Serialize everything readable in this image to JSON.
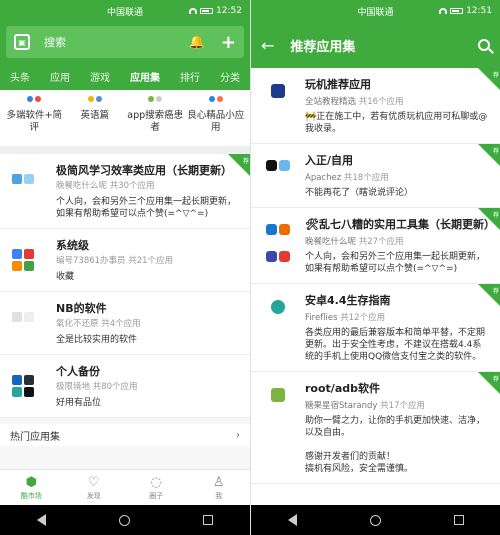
{
  "colors": {
    "accent": "#3faa3e",
    "accent_light": "#5ec15c"
  },
  "left": {
    "status": {
      "carrier": "中国联通",
      "time": "12:52"
    },
    "search_placeholder": "搜索",
    "tabs": [
      {
        "label": "头条"
      },
      {
        "label": "应用"
      },
      {
        "label": "游戏"
      },
      {
        "label": "应用集",
        "active": true
      },
      {
        "label": "排行"
      },
      {
        "label": "分类"
      }
    ],
    "categories": [
      {
        "label": "多端软件+简评"
      },
      {
        "label": "英语篇"
      },
      {
        "label": "app搜索癌患者"
      },
      {
        "label": "良心精品小应用"
      }
    ],
    "cards": [
      {
        "title": "极简风学习效率类应用（长期更新）",
        "author": "晚餐吃什么呢",
        "count": "共30个应用",
        "desc": "个人向，会和另外三个应用集一起长期更新，如果有帮助希望可以点个赞(=^▽^=)"
      },
      {
        "title": "系统级",
        "author": "编号73861办事员",
        "count": "共21个应用",
        "desc": "收藏"
      },
      {
        "title": "NB的软件",
        "author": "氧化不还原",
        "count": "共4个应用",
        "desc": "全是比较实用的软件"
      },
      {
        "title": "个人备份",
        "author": "极限境地",
        "count": "共80个应用",
        "desc": "好用有品位"
      }
    ],
    "section_title": "热门应用集",
    "bottom_nav": [
      {
        "label": "酷市场",
        "icon": "store-icon",
        "active": true
      },
      {
        "label": "发现",
        "icon": "bulb-icon"
      },
      {
        "label": "圈子",
        "icon": "circle-plus-icon"
      },
      {
        "label": "我",
        "icon": "person-icon"
      }
    ]
  },
  "right": {
    "status": {
      "carrier": "中国联通",
      "time": "12:51"
    },
    "title": "推荐应用集",
    "cards": [
      {
        "title": "玩机推荐应用",
        "author": "全站教程精选",
        "count": "共16个应用",
        "desc": "🚧正在施工中，若有优质玩机应用可私聊或@我收录。"
      },
      {
        "title": "入正/自用",
        "author": "Apachez",
        "count": "共18个应用",
        "desc": "不能再花了（瞎说说评论）"
      },
      {
        "title": "🛠乱七八糟的实用工具集（长期更新）",
        "author": "晚餐吃什么呢",
        "count": "共27个应用",
        "desc": "个人向，会和另外三个应用集一起长期更新，如果有帮助希望可以点个赞(=^▽^=)"
      },
      {
        "title": "安卓4.4生存指南",
        "author": "Fireflies",
        "count": "共12个应用",
        "desc": "各类应用的最后兼容版本和简单平替，不定期更新。出于安全性考虑，不建议在搭载4.4系统的手机上使用QQ微信支付宝之类的软件。"
      },
      {
        "title": "root/adb软件",
        "author": "糖果星宿Starandy",
        "count": "共17个应用",
        "desc": "助你一臂之力，让你的手机更加快速、洁净，以及自由。\n\n感谢开发者们的贡献！\n搞机有风险，安全需谨慎。"
      }
    ]
  },
  "ribbon_label": "荐"
}
